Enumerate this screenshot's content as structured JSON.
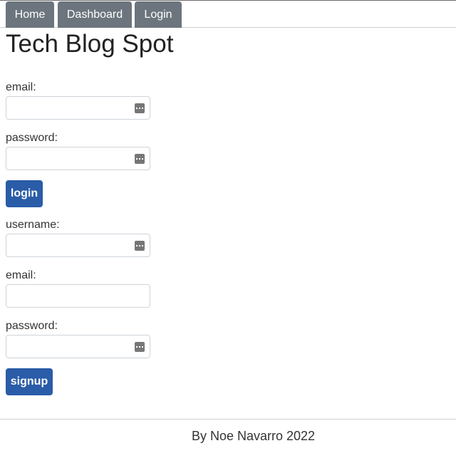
{
  "nav": {
    "items": [
      {
        "label": "Home"
      },
      {
        "label": "Dashboard"
      },
      {
        "label": "Login"
      }
    ]
  },
  "header": {
    "title": "Tech Blog Spot"
  },
  "login_form": {
    "email_label": "email:",
    "email_value": "",
    "password_label": "password:",
    "password_value": "",
    "submit_label": "login"
  },
  "signup_form": {
    "username_label": "username:",
    "username_value": "",
    "email_label": "email:",
    "email_value": "",
    "password_label": "password:",
    "password_value": "",
    "submit_label": "signup"
  },
  "footer": {
    "text": "By Noe Navarro 2022"
  },
  "colors": {
    "nav_button": "#6c757d",
    "primary_button": "#2a5ca8"
  },
  "icons": {
    "field_autofill": "autofill-dots-icon"
  }
}
